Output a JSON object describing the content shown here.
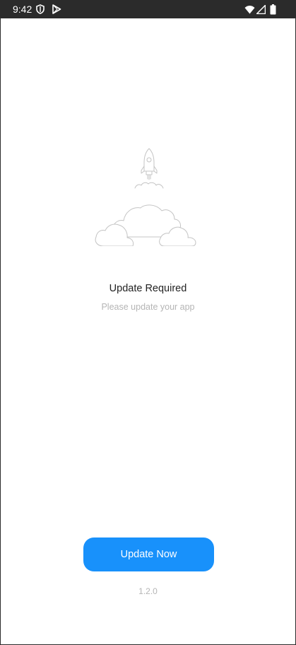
{
  "status_bar": {
    "time": "9:42",
    "left_icons": [
      "shield-icon",
      "play-store-icon"
    ],
    "right_icons": [
      "wifi-icon",
      "signal-icon",
      "battery-icon"
    ]
  },
  "main": {
    "illustration": "rocket-over-clouds-icon",
    "title": "Update Required",
    "subtitle": "Please update your app",
    "update_button_label": "Update Now",
    "version": "1.2.0"
  },
  "colors": {
    "accent": "#1891fb",
    "status_bar_bg": "#2b2b2b",
    "subtitle_text": "#b5b5b5",
    "title_text": "#222222"
  }
}
